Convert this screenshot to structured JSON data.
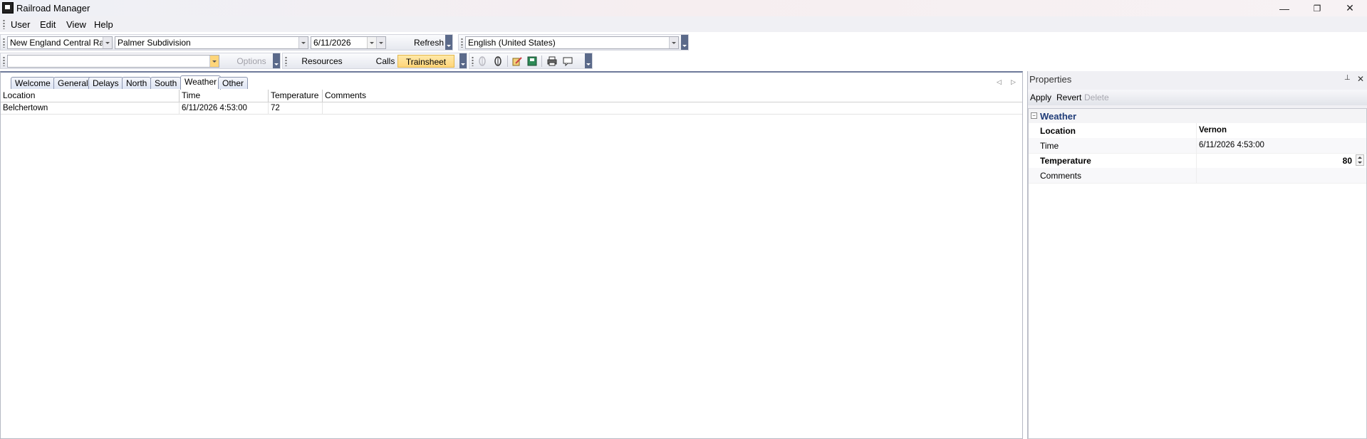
{
  "window": {
    "title": "Railroad Manager",
    "minimize_glyph": "—",
    "restore_glyph": "❐",
    "close_glyph": "✕"
  },
  "menu": {
    "items": [
      "User",
      "Edit",
      "View",
      "Help"
    ]
  },
  "toolbar1": {
    "railroad": "New England Central Railroad",
    "subdivision": "Palmer Subdivision",
    "date": "6/11/2026",
    "refresh_label": "Refresh",
    "language": "English (United States)"
  },
  "toolbar2": {
    "search_value": "",
    "options_label": "Options",
    "resources_label": "Resources",
    "calls_label": "Calls",
    "trainsheet_label": "Trainsheet",
    "icons": [
      "phone-disabled-icon",
      "phone-icon",
      "edit-icon",
      "save-icon",
      "print-icon",
      "comment-icon"
    ]
  },
  "tabs": [
    "Welcome",
    "General",
    "Delays",
    "North",
    "South",
    "Weather",
    "Other"
  ],
  "active_tab": "Weather",
  "grid": {
    "columns": [
      "Location",
      "Time",
      "Temperature",
      "Comments"
    ],
    "rows": [
      {
        "location": "Belchertown",
        "time": "6/11/2026 4:53:00",
        "temperature": "72",
        "comments": ""
      }
    ]
  },
  "properties": {
    "title": "Properties",
    "pin_glyph": "📌",
    "close_glyph": "✕",
    "apply_label": "Apply",
    "revert_label": "Revert",
    "delete_label": "Delete",
    "category": "Weather",
    "fields": {
      "location_label": "Location",
      "location_value": "Vernon",
      "time_label": "Time",
      "time_value": "6/11/2026 4:53:00",
      "temperature_label": "Temperature",
      "temperature_value": "80",
      "comments_label": "Comments",
      "comments_value": ""
    }
  },
  "colors": {
    "accent_highlight": "#ffd57a",
    "category_text": "#1f3c78"
  }
}
